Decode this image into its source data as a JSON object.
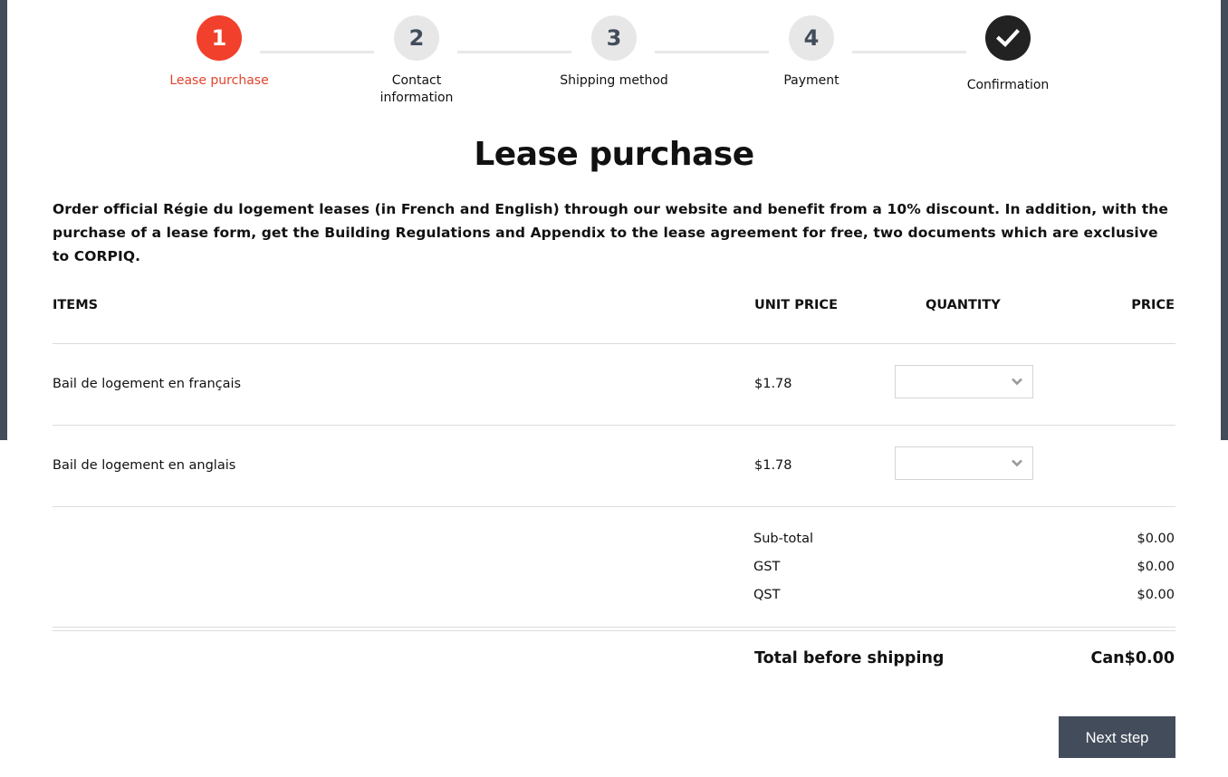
{
  "stepper": {
    "steps": [
      {
        "number": "1",
        "label": "Lease purchase",
        "state": "active"
      },
      {
        "number": "2",
        "label": "Contact information",
        "state": "pending"
      },
      {
        "number": "3",
        "label": "Shipping method",
        "state": "pending"
      },
      {
        "number": "4",
        "label": "Payment",
        "state": "pending"
      },
      {
        "number": "",
        "label": "Confirmation",
        "state": "done",
        "icon": "checkmark-icon"
      }
    ]
  },
  "page": {
    "title": "Lease purchase",
    "intro": "Order official Régie du logement leases (in French and English) through our website and benefit from a 10% discount. In addition, with the purchase of a lease form, get the Building Regulations and Appendix to the lease agreement for free, two documents which are exclusive to CORPIQ."
  },
  "table": {
    "headers": {
      "items": "ITEMS",
      "unit_price": "UNIT PRICE",
      "quantity": "QUANTITY",
      "price": "PRICE"
    },
    "rows": [
      {
        "name": "Bail de logement en français",
        "unit_price": "$1.78",
        "quantity": "",
        "price": ""
      },
      {
        "name": "Bail de logement en anglais",
        "unit_price": "$1.78",
        "quantity": "",
        "price": ""
      }
    ]
  },
  "summary": {
    "subtotal_label": "Sub-total",
    "subtotal": "$0.00",
    "gst_label": "GST",
    "gst": "$0.00",
    "qst_label": "QST",
    "qst": "$0.00",
    "total_label": "Total before shipping",
    "total": "Can$0.00"
  },
  "actions": {
    "next_label": "Next step"
  },
  "colors": {
    "accent": "#f1402b",
    "dark": "#434c5b",
    "done": "#222222",
    "pending": "#e7e7e8"
  }
}
